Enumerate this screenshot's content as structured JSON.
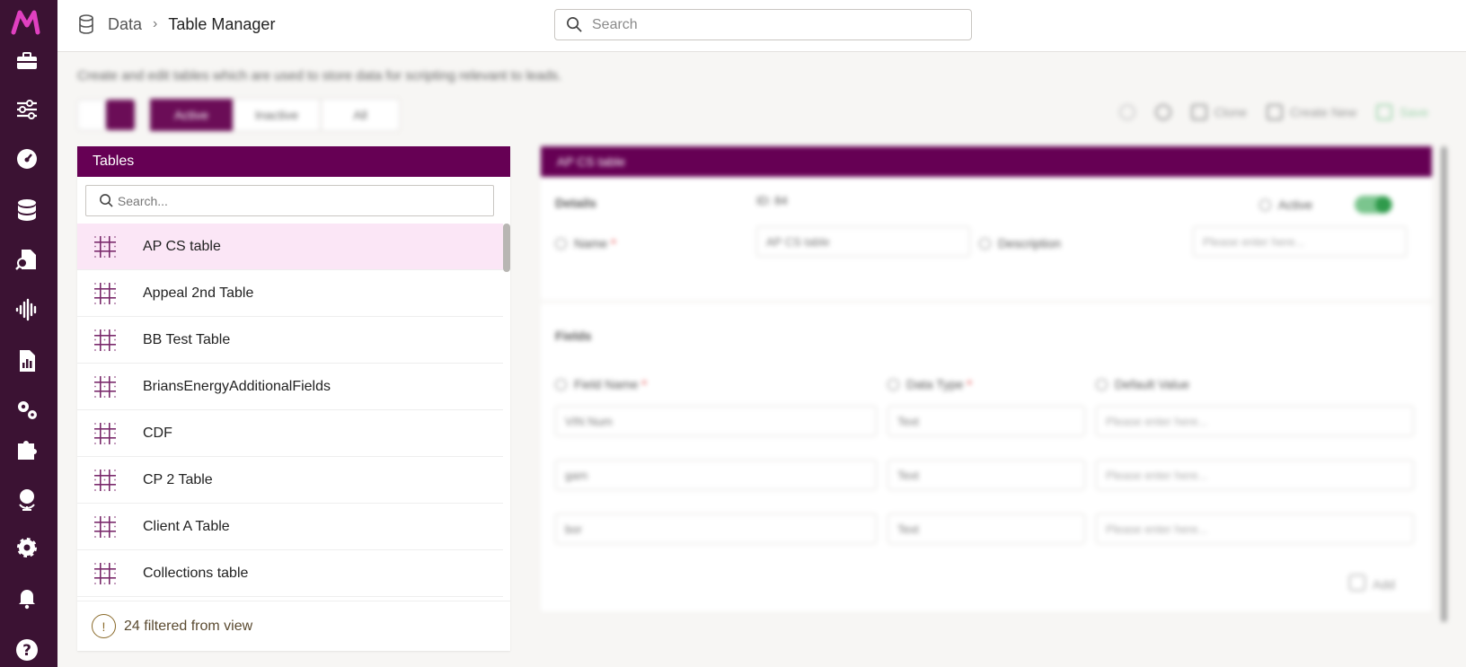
{
  "breadcrumb": {
    "root": "Data",
    "separator": "›",
    "current": "Table Manager"
  },
  "top_search": {
    "placeholder": "Search"
  },
  "page": {
    "description": "Create and edit tables which are used to store data for scripting relevant to leads.",
    "filter_tabs": [
      "Active",
      "Inactive",
      "All"
    ],
    "toolbar": {
      "clone": "Clone",
      "create_new": "Create New",
      "save": "Save"
    }
  },
  "tables_panel": {
    "title": "Tables",
    "search_placeholder": "Search...",
    "items": [
      "AP CS table",
      "Appeal 2nd Table",
      "BB Test Table",
      "BriansEnergyAdditionalFields",
      "CDF",
      "CP 2 Table",
      "Client A Table",
      "Collections table"
    ],
    "selected_index": 0,
    "footer": "24 filtered from view"
  },
  "detail": {
    "title": "AP CS table",
    "details_label": "Details",
    "id_label": "ID: 84",
    "active_label": "Active",
    "name_label": "Name",
    "name_value": "AP CS table",
    "description_label": "Description",
    "description_placeholder": "Please enter here...",
    "fields_label": "Fields",
    "col_field_name": "Field Name",
    "col_data_type": "Data Type",
    "col_default_value": "Default Value",
    "rows": [
      {
        "name": "VIN Num",
        "type": "Text",
        "default": "Please enter here..."
      },
      {
        "name": "gam",
        "type": "Text",
        "default": "Please enter here..."
      },
      {
        "name": "bor",
        "type": "Text",
        "default": "Please enter here..."
      }
    ],
    "add_label": "Add"
  },
  "colors": {
    "brand": "#660054",
    "rail": "#3b1233",
    "selected_row": "#fbe6f6",
    "logo": "#e040c0"
  }
}
